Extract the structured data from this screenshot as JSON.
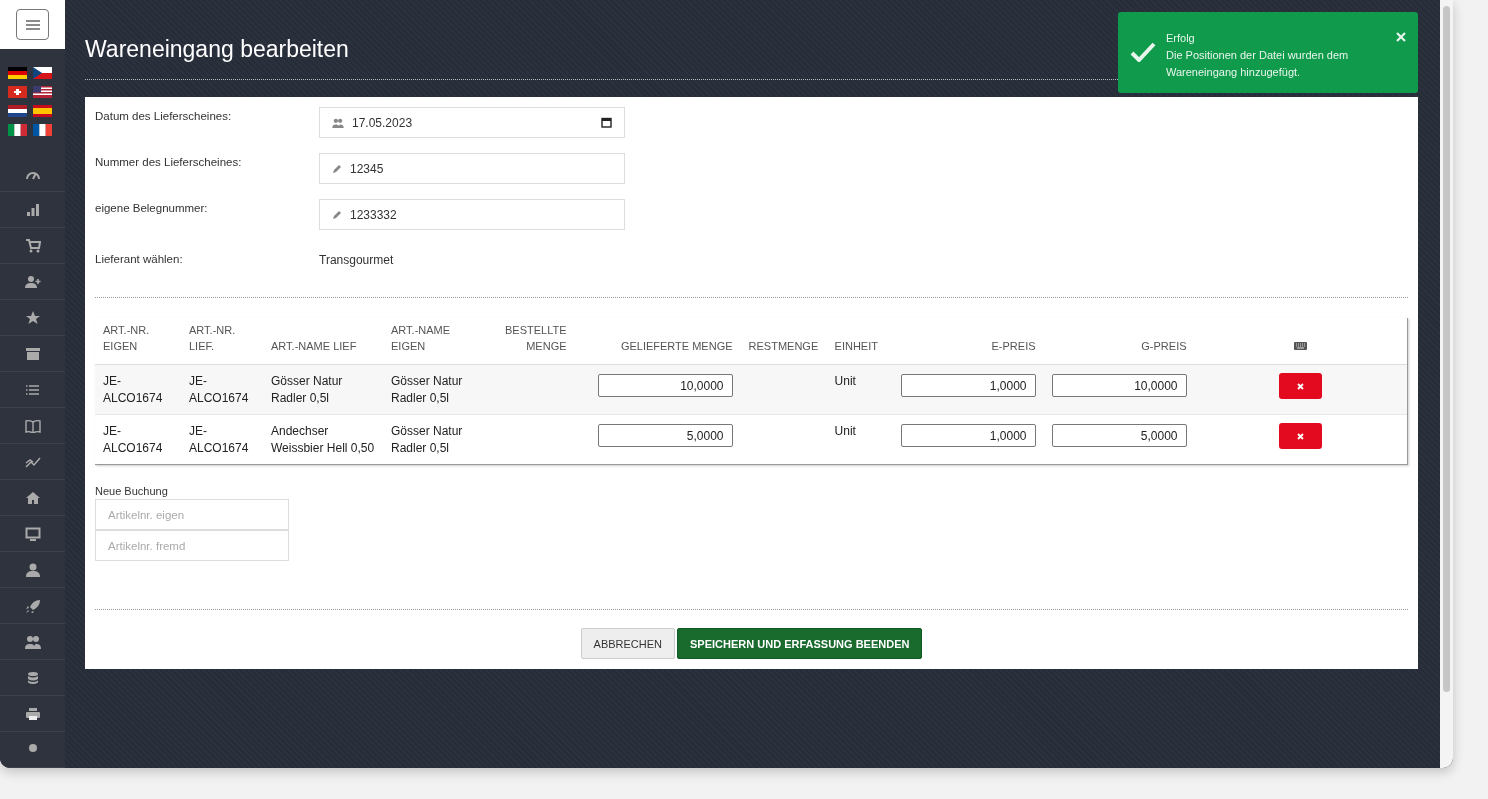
{
  "page_title": "Wareneingang bearbeiten",
  "toast": {
    "title": "Erfolg",
    "message": "Die Positionen der Datei wurden dem Wareneingang hinzugefügt."
  },
  "form": [
    {
      "label": "Datum des Lieferscheines:",
      "kind": "date",
      "value": "17.05.2023"
    },
    {
      "label": "Nummer des Lieferscheines:",
      "kind": "text",
      "value": "12345"
    },
    {
      "label": "eigene Belegnummer:",
      "kind": "text",
      "value": "1233332"
    },
    {
      "label": "Lieferant wählen:",
      "kind": "static",
      "value": "Transgourmet"
    }
  ],
  "table": {
    "columns": [
      {
        "label": "ART.-NR.\nEIGEN"
      },
      {
        "label": "ART.-NR.\nLIEF."
      },
      {
        "label": "ART.-NAME LIEF"
      },
      {
        "label": "ART.-NAME\nEIGEN"
      },
      {
        "label": "BESTELLTE\nMENGE"
      },
      {
        "label": "GELIEFERTE MENGE"
      },
      {
        "label": "RESTMENGE"
      },
      {
        "label": "EINHEIT"
      },
      {
        "label": "E-PREIS"
      },
      {
        "label": "G-PREIS"
      }
    ],
    "rows": [
      {
        "art_nr_eigen": "JE-\nALCO1674",
        "art_nr_lief": "JE-\nALCO1674",
        "name_lief": "Gösser Natur\nRadler 0,5l",
        "name_eigen": "Gösser Natur\nRadler 0,5l",
        "delivered": "10,0000",
        "unit": "Unit",
        "e_price": "1,0000",
        "g_price": "10,0000"
      },
      {
        "art_nr_eigen": "JE-\nALCO1674",
        "art_nr_lief": "JE-\nALCO1674",
        "name_lief": "Andechser\nWeissbier Hell 0,50",
        "name_eigen": "Gösser Natur\nRadler 0,5l",
        "delivered": "5,0000",
        "unit": "Unit",
        "e_price": "1,0000",
        "g_price": "5,0000"
      }
    ]
  },
  "new_booking": {
    "title": "Neue Buchung",
    "fields": [
      {
        "placeholder": "Artikelnr. eigen"
      },
      {
        "placeholder": "Artikelnr. fremd"
      }
    ]
  },
  "buttons": [
    {
      "label": "ABBRECHEN",
      "kind": "secondary"
    },
    {
      "label": "SPEICHERN UND ERFASSUNG BEENDEN",
      "kind": "primary"
    }
  ]
}
